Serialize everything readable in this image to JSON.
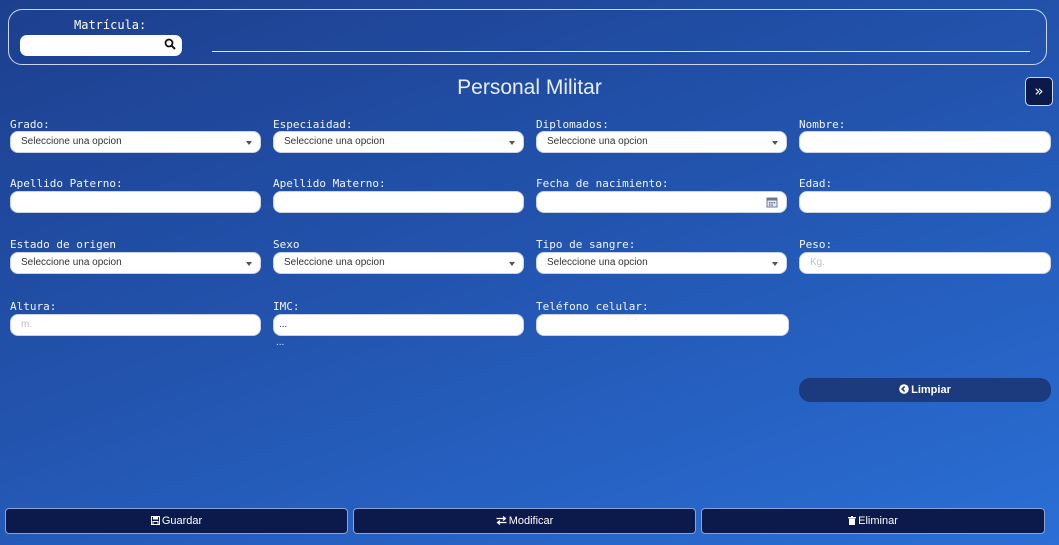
{
  "search": {
    "label": "Matrícula:",
    "value": ""
  },
  "page_title": "Personal Militar",
  "expand_glyph": "»",
  "fields": {
    "grado": {
      "label": "Grado:",
      "value": "Seleccione una opcion"
    },
    "especialidad": {
      "label": "Especiaidad:",
      "value": "Seleccione una opcion"
    },
    "diplomados": {
      "label": "Diplomados:",
      "value": "Seleccione una opcion"
    },
    "nombre": {
      "label": "Nombre:",
      "value": ""
    },
    "apellido_paterno": {
      "label": "Apellido Paterno:",
      "value": ""
    },
    "apellido_materno": {
      "label": "Apellido Materno:",
      "value": ""
    },
    "fecha_nacimiento": {
      "label": "Fecha de nacimiento:",
      "value": ""
    },
    "edad": {
      "label": "Edad:",
      "value": ""
    },
    "estado_origen": {
      "label": "Estado de origen",
      "value": "Seleccione una opcion"
    },
    "sexo": {
      "label": "Sexo",
      "value": "Seleccione una opcion"
    },
    "tipo_sangre": {
      "label": "Tipo de sangre:",
      "value": "Seleccione una opcion"
    },
    "peso": {
      "label": "Peso:",
      "placeholder": "Kg."
    },
    "altura": {
      "label": "Altura:",
      "placeholder": "m."
    },
    "imc": {
      "label": "IMC:",
      "value": "...",
      "extra": "..."
    },
    "telefono": {
      "label": "Teléfono celular:",
      "value": ""
    }
  },
  "buttons": {
    "limpiar": "Limpiar",
    "guardar": "Guardar",
    "modificar": "Modificar",
    "eliminar": "Eliminar"
  },
  "icons": {
    "search": "search-icon",
    "expand": "double-chevron-right-icon",
    "calendar": "calendar-icon",
    "limpiar": "circle-arrow-left-icon",
    "guardar": "save-icon",
    "modificar": "exchange-icon",
    "eliminar": "trash-icon"
  },
  "colors": {
    "background_start": "#1d3f8e",
    "background_end": "#2a6fd6",
    "button_dark": "#0b1a4a",
    "limpiar_bg": "#1c3a7e"
  }
}
